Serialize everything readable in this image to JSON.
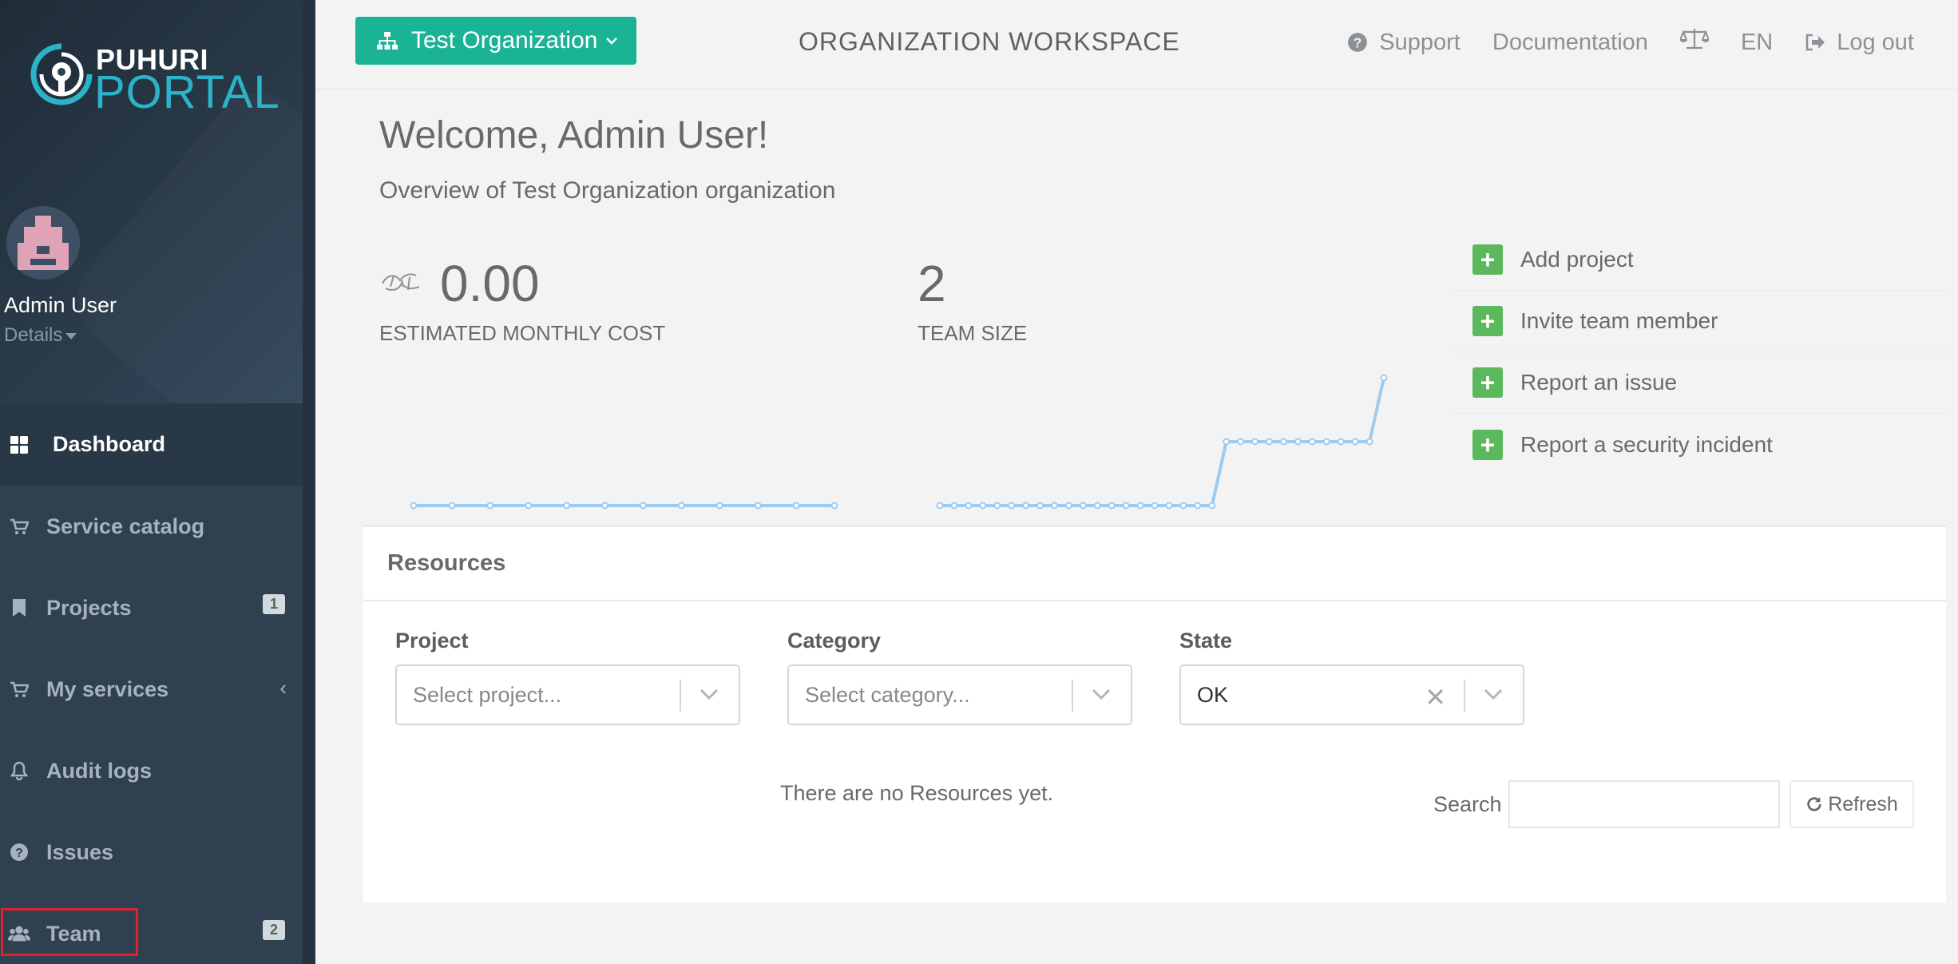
{
  "brand": {
    "line1": "PUHURI",
    "line2": "PORTAL"
  },
  "user": {
    "name": "Admin User",
    "details_label": "Details"
  },
  "sidebar": {
    "items": [
      {
        "label": "Dashboard",
        "icon": "dashboard-icon",
        "active": true
      },
      {
        "label": "Service catalog",
        "icon": "cart-icon"
      },
      {
        "label": "Projects",
        "icon": "bookmark-icon",
        "badge": "1"
      },
      {
        "label": "My services",
        "icon": "cart-icon",
        "chevron": "‹"
      },
      {
        "label": "Audit logs",
        "icon": "bell-icon"
      },
      {
        "label": "Issues",
        "icon": "question-icon"
      },
      {
        "label": "Team",
        "icon": "users-icon",
        "badge": "2"
      }
    ]
  },
  "topbar": {
    "org_button": "Test Organization",
    "workspace_title": "ORGANIZATION WORKSPACE",
    "links": {
      "support": "Support",
      "documentation": "Documentation",
      "language": "EN",
      "logout": "Log out"
    }
  },
  "main": {
    "welcome": "Welcome, Admin User!",
    "overview": "Overview of Test Organization organization",
    "stats": {
      "cost_value": "0.00",
      "cost_label": "ESTIMATED MONTHLY COST",
      "team_value": "2",
      "team_label": "TEAM SIZE"
    },
    "actions": [
      "Add project",
      "Invite team member",
      "Report an issue",
      "Report a security incident"
    ]
  },
  "resources": {
    "title": "Resources",
    "filters": {
      "project_label": "Project",
      "project_placeholder": "Select project...",
      "category_label": "Category",
      "category_placeholder": "Select category...",
      "state_label": "State",
      "state_value": "OK"
    },
    "empty_message": "There are no Resources yet.",
    "search_label": "Search",
    "refresh_label": "Refresh"
  },
  "colors": {
    "sidebar_bg": "#2f4050",
    "accent": "#1ab394",
    "action_green": "#5cb85c",
    "spark_line": "#9ecbf0",
    "highlight": "#e0212e"
  },
  "chart_data": [
    {
      "type": "line",
      "x": [
        1,
        2,
        3,
        4,
        5,
        6,
        7,
        8,
        9,
        10,
        11,
        12
      ],
      "series": [
        {
          "values": [
            0,
            0,
            0,
            0,
            0,
            0,
            0,
            0,
            0,
            0,
            0,
            0
          ]
        }
      ]
    },
    {
      "type": "line",
      "x": [
        1,
        2,
        3,
        4,
        5,
        6,
        7,
        8,
        9,
        10,
        11,
        12,
        13,
        14,
        15,
        16,
        17,
        18,
        19,
        20,
        21,
        22,
        23,
        24,
        25,
        26,
        27,
        28,
        29,
        30,
        31,
        32
      ],
      "series": [
        {
          "values": [
            0,
            0,
            0,
            0,
            0,
            0,
            0,
            0,
            0,
            0,
            0,
            0,
            0,
            0,
            0,
            0,
            0,
            0,
            0,
            0,
            1,
            1,
            1,
            1,
            1,
            1,
            1,
            1,
            1,
            1,
            1,
            2
          ]
        }
      ]
    }
  ]
}
